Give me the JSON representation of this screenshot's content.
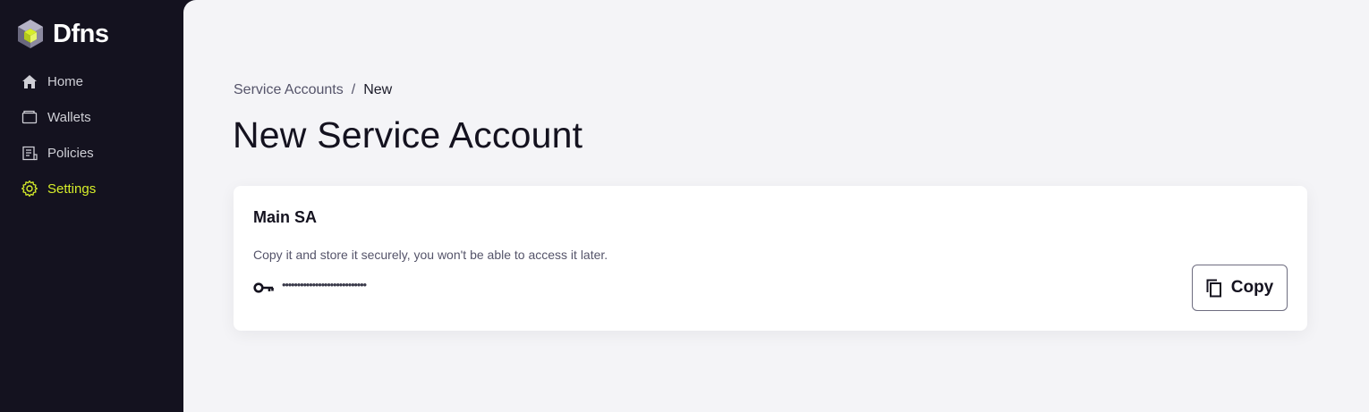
{
  "app": {
    "name": "Dfns"
  },
  "sidebar": {
    "items": [
      {
        "label": "Home",
        "icon": "home-icon",
        "active": false
      },
      {
        "label": "Wallets",
        "icon": "wallet-icon",
        "active": false
      },
      {
        "label": "Policies",
        "icon": "policies-icon",
        "active": false
      },
      {
        "label": "Settings",
        "icon": "gear-icon",
        "active": true
      }
    ]
  },
  "breadcrumb": {
    "parent": "Service Accounts",
    "separator": "/",
    "current": "New"
  },
  "page": {
    "title": "New Service Account"
  },
  "card": {
    "title": "Main SA",
    "description": "Copy it and store it securely, you won't be able to access it later.",
    "secret_mask": "••••••••••••••••••••••••••••",
    "copy_label": "Copy"
  },
  "colors": {
    "sidebar_bg": "#14121f",
    "accent": "#d7ee2a",
    "main_bg": "#f4f4f7"
  }
}
